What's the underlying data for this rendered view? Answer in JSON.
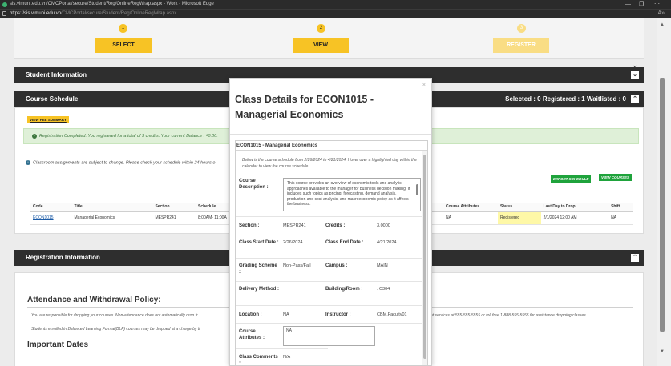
{
  "browser": {
    "title": "sis.vimuni.edu.vn/CMCPortal/secure/Student/Reg/OnlineRegWrap.aspx - Work - Microsoft Edge",
    "url_host": "https://sis.vimuni.edu.vn",
    "url_path": "/CMCPortal/secure/Student/Reg/OnlineRegWrap.aspx",
    "minimize": "—",
    "restore": "❐",
    "more": "⋯"
  },
  "steps": [
    {
      "num": "1",
      "label": "SELECT"
    },
    {
      "num": "2",
      "label": "VIEW"
    },
    {
      "num": "3",
      "label": "REGISTER"
    }
  ],
  "sections": {
    "student_info": "Student Information",
    "course_schedule": "Course Schedule",
    "registration_info": "Registration Information"
  },
  "counts": "Selected : 0  Registered : 1  Waitlisted : 0",
  "schedule": {
    "fee_link": "VIEW FEE SUMMARY",
    "alert": "Registration Completed. You registered for a total of 3 credits. Your current Balance : ₫0.00.",
    "info": "Classroom assignments are subject to change. Please check your schedule within 24 hours o",
    "export_btn": "EXPORT SCHEDULE",
    "view_btn": "VIEW COURSES",
    "columns": [
      "Code",
      "Title",
      "Section",
      "Schedule",
      "Course Attributes",
      "Status",
      "Last Day to Drop",
      "Shift"
    ],
    "row": {
      "code": "ECON1015",
      "title": "Managerial Economics",
      "section": "MESPR241",
      "schedule": "8:00AM- 11:00A",
      "attributes": "NA",
      "status": "Registered",
      "last_drop": "2/1/2024 12:00 AM",
      "shift": "NA"
    }
  },
  "registration": {
    "heading": "Attendance and Withdrawal Policy:",
    "text1": "You are responsible for dropping your courses. Non-attendance does not automatically drop fr",
    "text1_right": "nt services at 555-555-5555 or toll free 1-888-555-5555 for assistance dropping classes.",
    "text2": "Students enrolled in Balanced Learning Format(BLF) courses may be dropped at a charge by tl",
    "dates_heading": "Important Dates"
  },
  "modal": {
    "close": "×",
    "title": "Class Details for ECON1015 - Managerial Economics",
    "inner_head": "ECON1015 - Managerial Economics",
    "note": "Below is the course schedule from 2/26/2024 to 4/21/2024. Hover over a highlighted day within the calendar to view the course schedule.",
    "desc_label": "Course Description :",
    "description": "This course provides an overview of economic tools and analytic approaches available to the manager for business decision making. It includes such topics as pricing, forecasting, demand analysis, production and cost analysis, and macroeconomic policy as it affects the business.",
    "labels": {
      "section": "Section :",
      "credits": "Credits :",
      "start": "Class Start Date :",
      "end": "Class End Date :",
      "grading": "Grading Scheme :",
      "campus": "Campus :",
      "delivery": "Delivery Method :",
      "building": "Building/Room :",
      "location": "Location :",
      "instructor": "Instructor :",
      "attributes": "Course Attributes :",
      "comments": "Class Comments :"
    },
    "values": {
      "section": "MESPR241",
      "credits": "3.0000",
      "start": "2/26/2024",
      "end": "4/21/2024",
      "grading": "Non-Pass/Fail",
      "campus": "MAIN",
      "delivery": "",
      "building": ": C304",
      "location": "NA",
      "instructor": "CBM,Faculty01",
      "attributes": "NA",
      "comments": "N/A"
    }
  }
}
